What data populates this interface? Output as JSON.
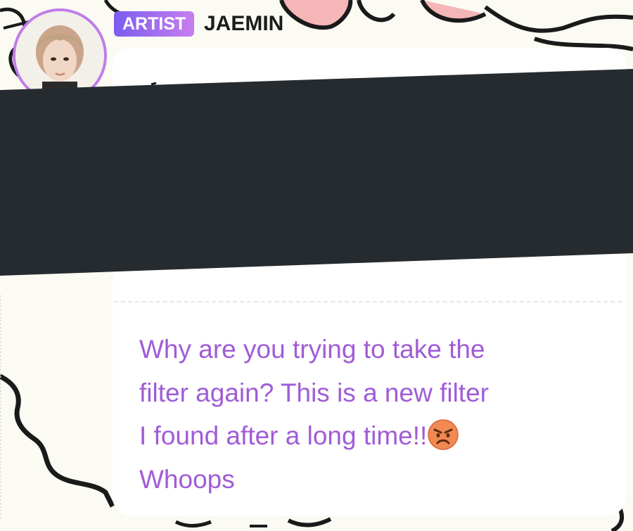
{
  "header": {
    "badge_label": "ARTIST",
    "artist_name": "JAEMIN"
  },
  "reply": {
    "lines": [
      "Why are you trying to take the",
      "filter again? This is a new filter",
      "I found after a long time!!",
      "Whoops"
    ],
    "emoji": "angry-face-icon"
  },
  "colors": {
    "badge_gradient_start": "#7b5cf0",
    "badge_gradient_end": "#c77ef0",
    "reply_text": "#a05cd6",
    "redaction_bar": "#262b2f",
    "avatar_ring": "#c07ce8"
  }
}
